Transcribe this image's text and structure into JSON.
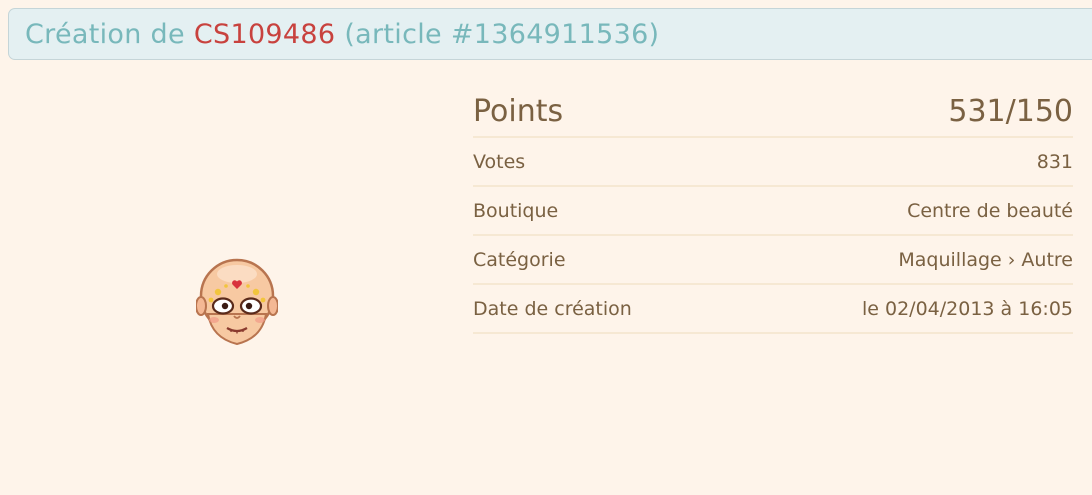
{
  "header": {
    "prefix": "Création de",
    "code": "CS109486",
    "article": "(article #1364911536)"
  },
  "details": {
    "points": {
      "label": "Points",
      "value": "531/150"
    },
    "votes": {
      "label": "Votes",
      "value": "831"
    },
    "boutique": {
      "label": "Boutique",
      "value": "Centre de beauté"
    },
    "categorie": {
      "label": "Catégorie",
      "value": "Maquillage › Autre"
    },
    "date": {
      "label": "Date de création",
      "value": "le 02/04/2013 à 16:05"
    }
  },
  "image": {
    "icon": "makeup-head-preview"
  },
  "colors": {
    "background": "#fef4ea",
    "header_background": "#e4f0f2",
    "header_text": "#78b8bb",
    "code_text": "#c8423e",
    "body_text": "#7a6142",
    "row_divider": "#f6e8d3"
  }
}
